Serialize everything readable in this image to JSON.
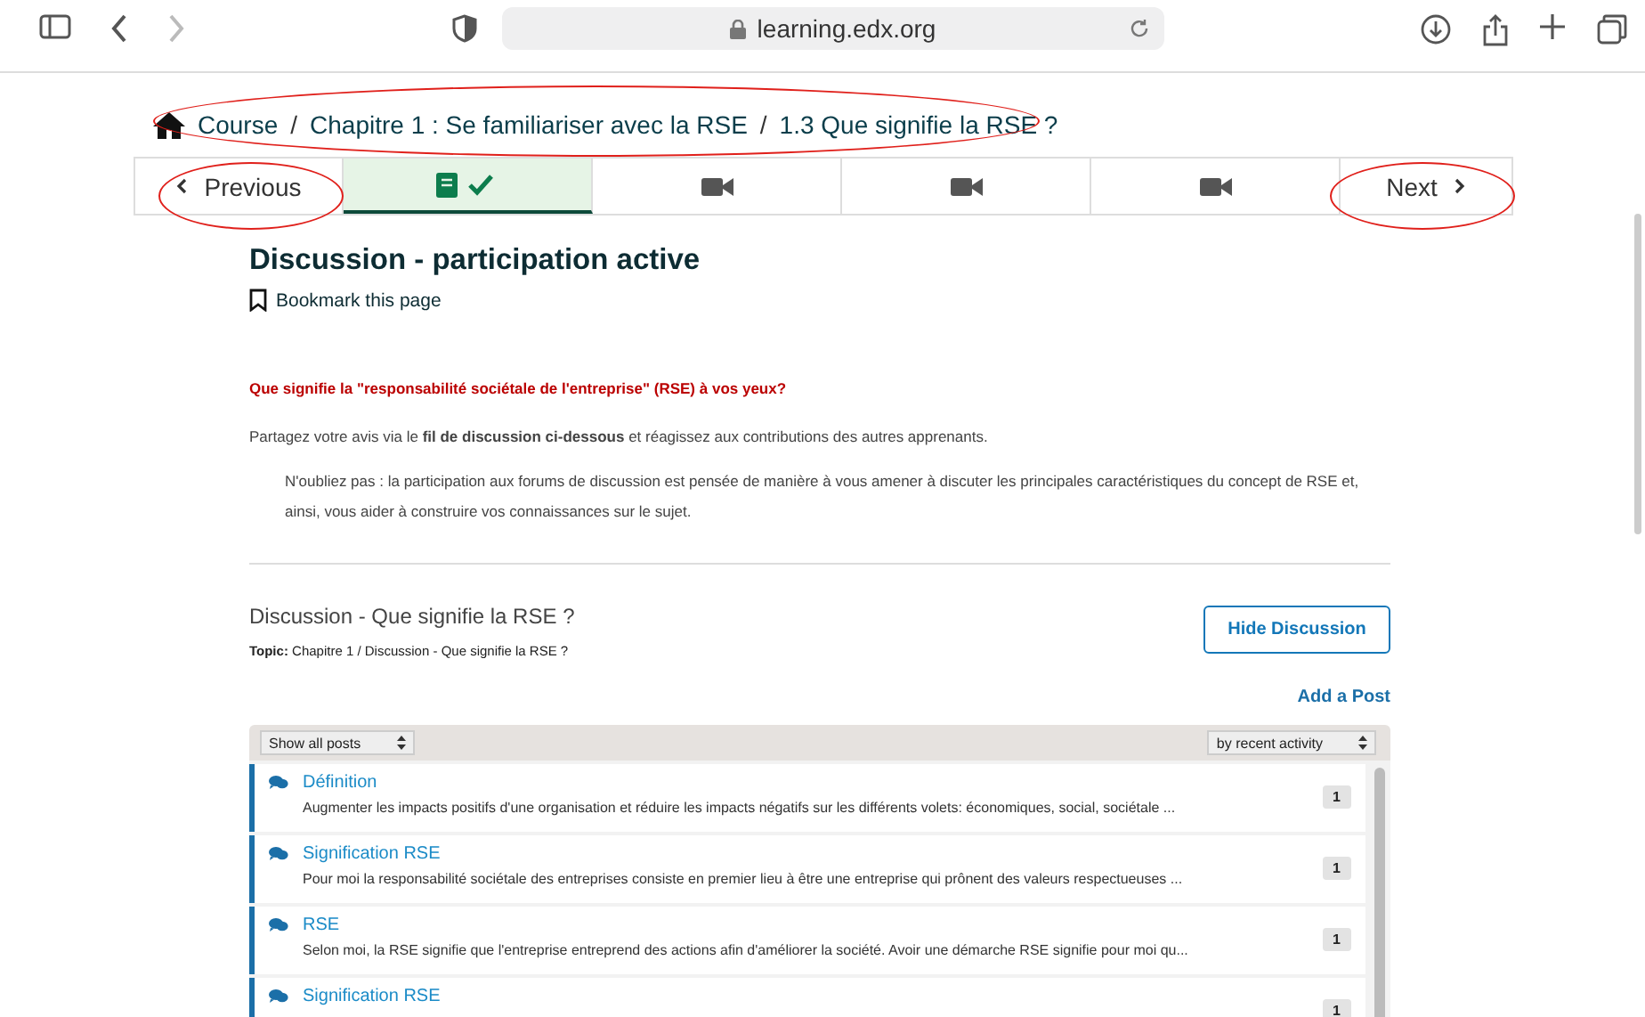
{
  "browser": {
    "url": "learning.edx.org"
  },
  "breadcrumb": [
    {
      "kind": "link",
      "text": "Course"
    },
    {
      "kind": "separator",
      "text": "/"
    },
    {
      "kind": "link",
      "text": "Chapitre 1 : Se familiariser avec la RSE"
    },
    {
      "kind": "separator",
      "text": "/"
    },
    {
      "kind": "link",
      "text": "1.3 Que signifie la RSE ?"
    }
  ],
  "unit_nav": [
    {
      "kind": "previous",
      "label": "Previous"
    },
    {
      "kind": "lesson",
      "selected": true
    },
    {
      "kind": "video",
      "selected": false
    },
    {
      "kind": "video",
      "selected": false
    },
    {
      "kind": "video",
      "selected": false
    },
    {
      "kind": "next",
      "label": "Next"
    }
  ],
  "unit_title": "Discussion - participation active",
  "bookmark": "Bookmark this page",
  "question": "Que signifie la \"responsabilité sociétale de l'entreprise\" (RSE) à vos yeux?",
  "intro": "Partagez votre avis via le **fil de discussion ci-dessous** et réagissez aux contributions des autres apprenants.",
  "note": "N'oubliez pas : la participation aux forums de discussion est pensée de manière à vous amener à discuter les principales caractéristiques du concept de RSE et, ainsi, vous aider à construire vos connaissances sur le sujet.",
  "discussion": {
    "title": "Discussion - Que signifie la RSE ?",
    "topic": "**Topic:** Chapitre 1 / Discussion - Que signifie la RSE ?",
    "hide_button": "Hide Discussion",
    "add_post": "Add a Post",
    "filter": "Show all posts",
    "sort": "by recent activity",
    "posts": [
      {
        "title": "Définition",
        "excerpt": "Augmenter les impacts positifs d'une organisation et réduire les impacts négatifs sur les différents volets: économiques, social, sociétale ...",
        "count": "1"
      },
      {
        "title": "Signification RSE",
        "excerpt": "Pour moi la responsabilité sociétale des entreprises consiste en premier lieu à être une entreprise qui prônent des valeurs respectueuses ...",
        "count": "1"
      },
      {
        "title": "RSE",
        "excerpt": "Selon moi, la RSE signifie que l'entreprise entreprend des actions afin d'améliorer la société. Avoir une démarche RSE signifie pour moi qu...",
        "count": "1"
      },
      {
        "title": "Signification RSE",
        "count": "1"
      }
    ]
  }
}
